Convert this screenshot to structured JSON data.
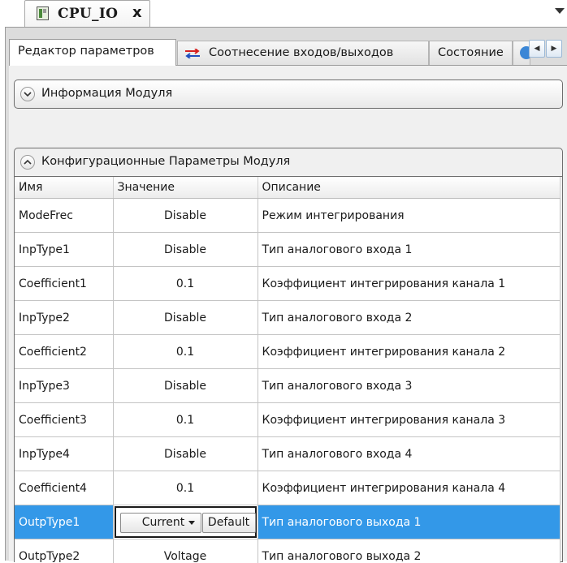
{
  "document_tab": {
    "title": "CPU_IO",
    "close_label": "x"
  },
  "subtabs": [
    {
      "label": "Редактор параметров"
    },
    {
      "label": "Соотнесение входов/выходов"
    },
    {
      "label": "Состояние"
    }
  ],
  "panels": {
    "module_info": {
      "title": "Информация Модуля"
    },
    "config_params": {
      "title": "Конфигурационные Параметры Модуля"
    }
  },
  "table": {
    "columns": [
      "Имя",
      "Значение",
      "Описание"
    ],
    "rows": [
      {
        "name": "ModeFrec",
        "value": "Disable",
        "description": "Режим интегрирования"
      },
      {
        "name": "InpType1",
        "value": "Disable",
        "description": "Тип аналогового входа 1"
      },
      {
        "name": "Coefficient1",
        "value": "0.1",
        "description": "Коэффициент интегрирования канала 1"
      },
      {
        "name": "InpType2",
        "value": "Disable",
        "description": "Тип аналогового входа 2"
      },
      {
        "name": "Coefficient2",
        "value": "0.1",
        "description": "Коэффициент интегрирования канала 2"
      },
      {
        "name": "InpType3",
        "value": "Disable",
        "description": "Тип аналогового входа 3"
      },
      {
        "name": "Coefficient3",
        "value": "0.1",
        "description": "Коэффициент интегрирования канала 3"
      },
      {
        "name": "InpType4",
        "value": "Disable",
        "description": "Тип аналогового входа 4"
      },
      {
        "name": "Coefficient4",
        "value": "0.1",
        "description": "Коэффициент интегрирования канала 4"
      },
      {
        "name": "OutpType1",
        "value": "Current",
        "description": "Тип аналогового выхода 1",
        "selected": true,
        "default_label": "Default"
      },
      {
        "name": "OutpType2",
        "value": "Voltage",
        "description": "Тип аналогового выхода 2"
      }
    ]
  },
  "colors": {
    "selection": "#3398e8",
    "map_icon": "#d62020"
  },
  "icons": [
    "module-icon",
    "close-icon",
    "dropdown-arrow-icon",
    "io-mapping-icon",
    "globe-icon",
    "scroll-left-icon",
    "scroll-right-icon",
    "chevron-down-icon",
    "chevron-up-icon"
  ]
}
